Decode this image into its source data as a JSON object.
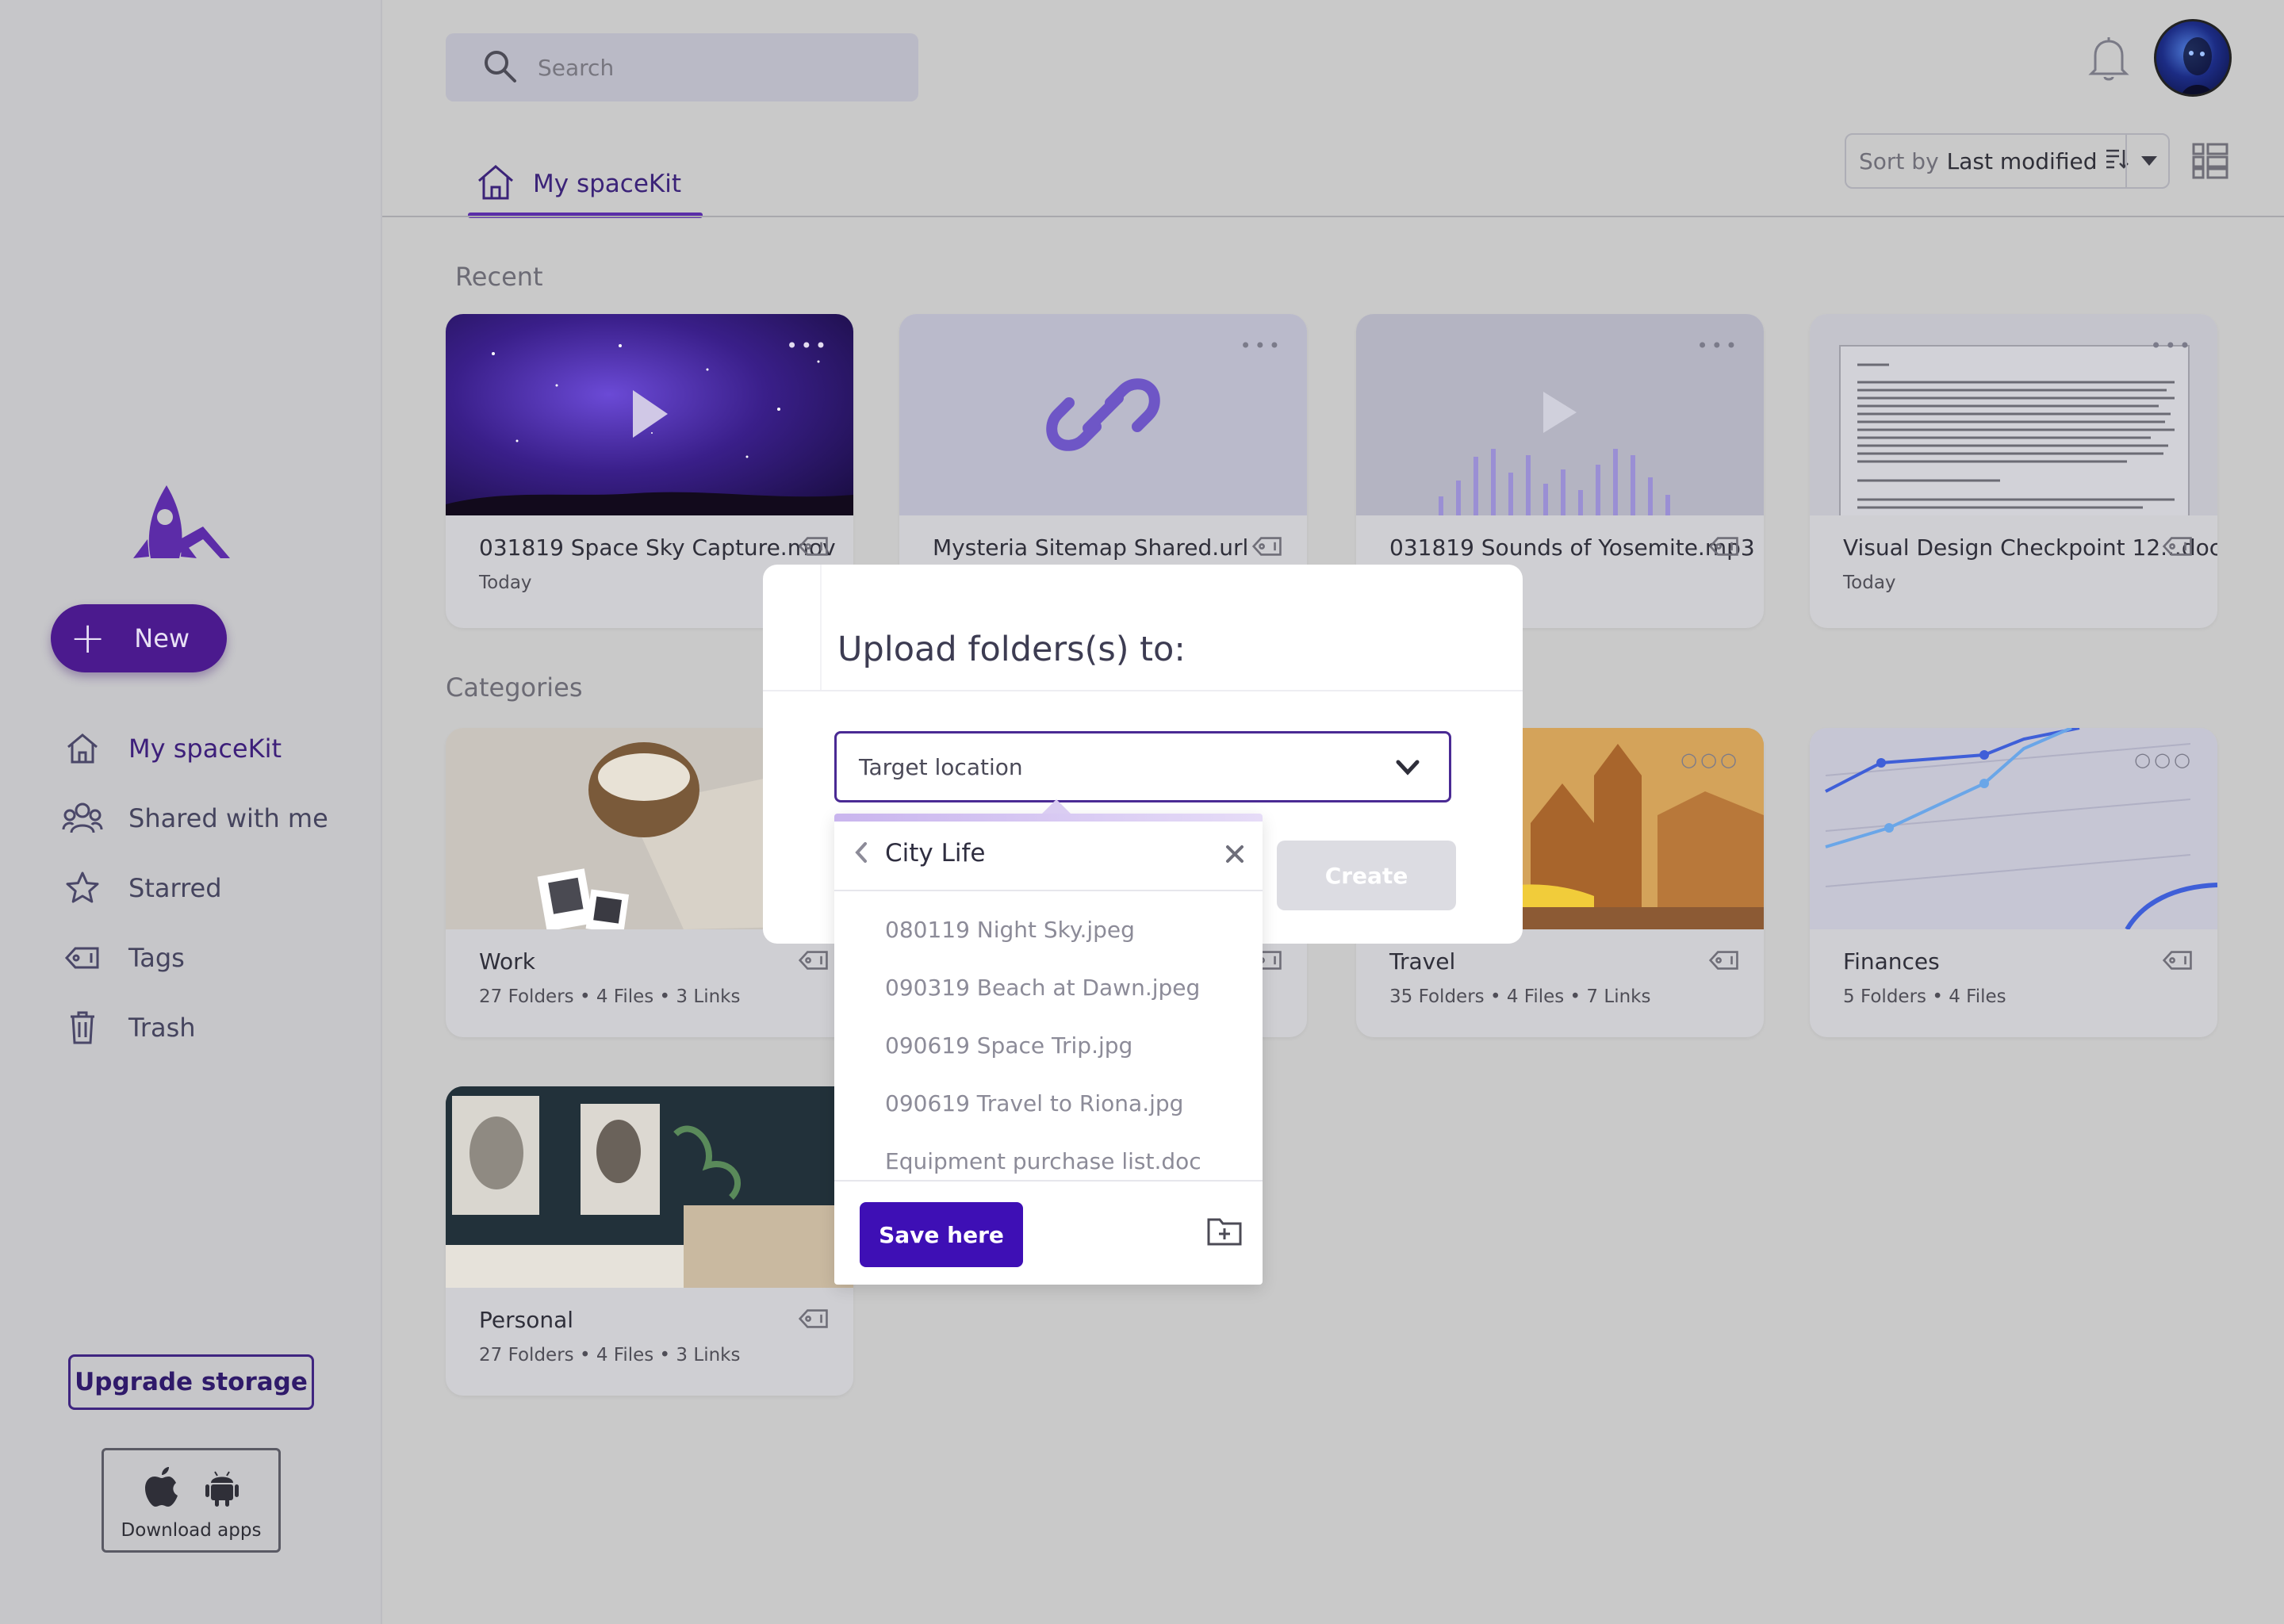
{
  "sidebar": {
    "new_label": "New",
    "nav": [
      {
        "label": "My spaceKit",
        "icon": "home-icon"
      },
      {
        "label": "Shared with me",
        "icon": "people-icon"
      },
      {
        "label": "Starred",
        "icon": "star-icon"
      },
      {
        "label": "Tags",
        "icon": "tag-icon"
      },
      {
        "label": "Trash",
        "icon": "trash-icon"
      }
    ],
    "upgrade_label": "Upgrade storage",
    "apps_label": "Download apps"
  },
  "header": {
    "search_placeholder": "Search",
    "tab_label": "My spaceKit",
    "sort_prefix": "Sort by",
    "sort_value": "Last modified"
  },
  "recent": {
    "title": "Recent",
    "items": [
      {
        "name": "031819 Space Sky Capture.mov",
        "meta": "Today",
        "kind": "video"
      },
      {
        "name": "Mysteria Sitemap Shared.url",
        "meta": "",
        "kind": "link"
      },
      {
        "name": "031819 Sounds of Yosemite.mp3",
        "meta": "",
        "kind": "audio"
      },
      {
        "name": "Visual Design Checkpoint 12...doc",
        "meta": "Today",
        "kind": "document"
      }
    ]
  },
  "categories": {
    "title": "Categories",
    "items": [
      {
        "name": "Work",
        "meta": "27 Folders • 4 Files • 3 Links"
      },
      {
        "name": "",
        "meta": ""
      },
      {
        "name": "Travel",
        "meta": "35 Folders • 4 Files • 7 Links"
      },
      {
        "name": "Finances",
        "meta": "5 Folders • 4 Files"
      },
      {
        "name": "Personal",
        "meta": "27 Folders • 4 Files • 3 Links"
      }
    ]
  },
  "modal": {
    "title": "Upload folders(s) to:",
    "target_placeholder": "Target location",
    "create_label": "Create"
  },
  "dropdown": {
    "folder": "City Life",
    "items": [
      "080119 Night Sky.jpeg",
      "090319 Beach at Dawn.jpeg",
      "090619 Space Trip.jpg",
      "090619 Travel to Riona.jpg",
      "Equipment purchase list.doc"
    ],
    "save_label": "Save here"
  },
  "colors": {
    "brand": "#4b1a8e",
    "primary_button": "#3e0fb5",
    "overlay": "#c9c9c9"
  }
}
